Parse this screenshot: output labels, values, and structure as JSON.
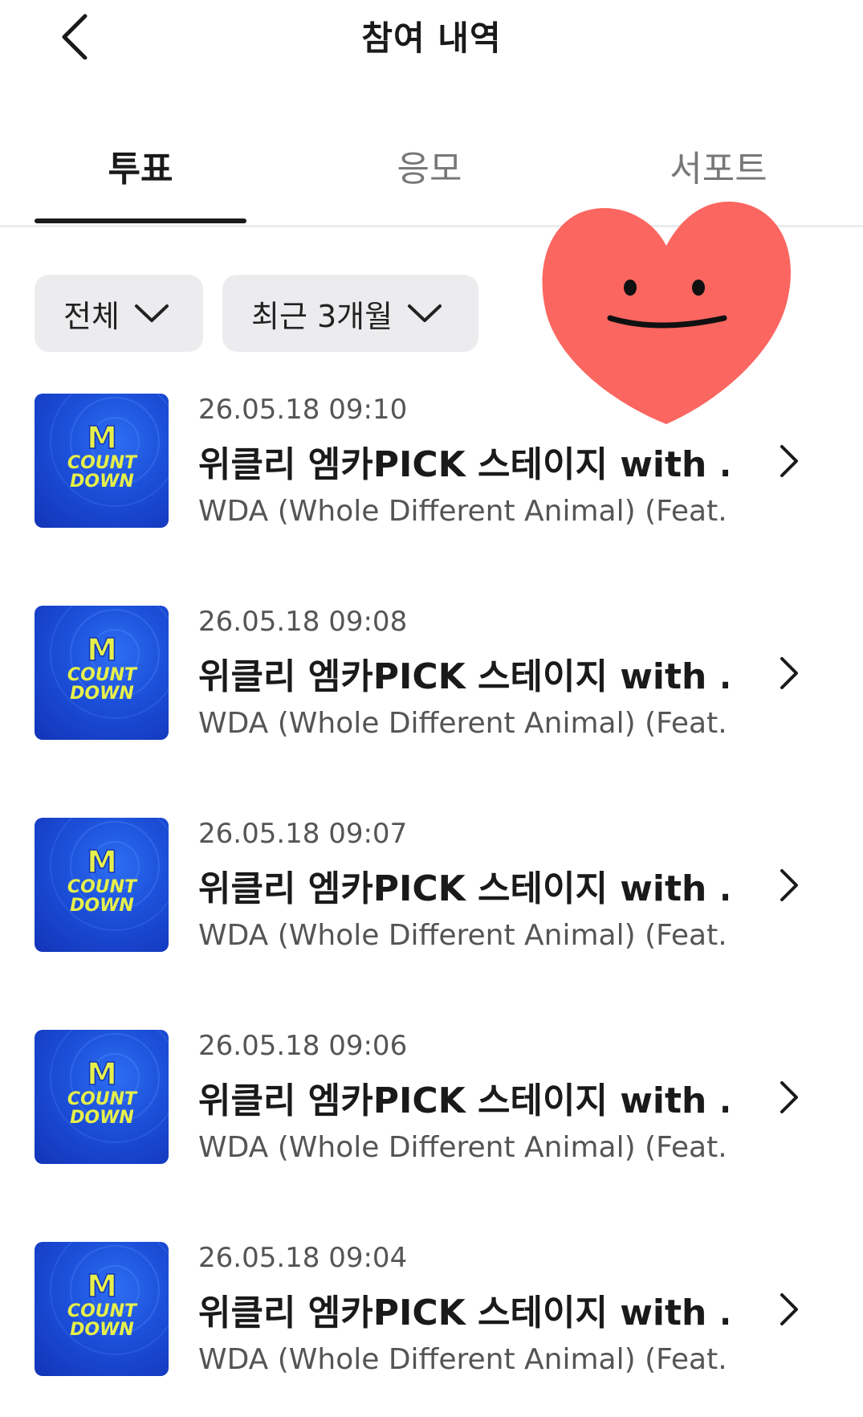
{
  "header": {
    "title": "참여 내역"
  },
  "tabs": [
    {
      "label": "투표",
      "active": true
    },
    {
      "label": "응모",
      "active": false
    },
    {
      "label": "서포트",
      "active": false
    }
  ],
  "filters": {
    "category": {
      "selected": "전체"
    },
    "period": {
      "selected": "최근 3개월"
    }
  },
  "items": [
    {
      "date": "26.05.18 09:10",
      "title": "위클리 엠카PICK 스테이지 with ...",
      "artist": "WDA (Whole Different Animal) (Feat...."
    },
    {
      "date": "26.05.18 09:08",
      "title": "위클리 엠카PICK 스테이지 with ...",
      "artist": "WDA (Whole Different Animal) (Feat...."
    },
    {
      "date": "26.05.18 09:07",
      "title": "위클리 엠카PICK 스테이지 with ...",
      "artist": "WDA (Whole Different Animal) (Feat...."
    },
    {
      "date": "26.05.18 09:06",
      "title": "위클리 엠카PICK 스테이지 with ...",
      "artist": "WDA (Whole Different Animal) (Feat...."
    },
    {
      "date": "26.05.18 09:04",
      "title": "위클리 엠카PICK 스테이지 with ...",
      "artist": "WDA (Whole Different Animal) (Feat...."
    }
  ],
  "thumbnail_logo": {
    "line1": "M",
    "line2": "COUNT",
    "line3": "DOWN"
  },
  "sticker": {
    "icon": "heart-smiley-sticker",
    "color": "#fb6660"
  },
  "colors": {
    "text_primary": "#1a1a1a",
    "text_secondary": "#555555",
    "filter_bg": "#ececef",
    "thumbnail_blue": "#1c4ed8",
    "logo_yellow": "#e6f04a"
  }
}
